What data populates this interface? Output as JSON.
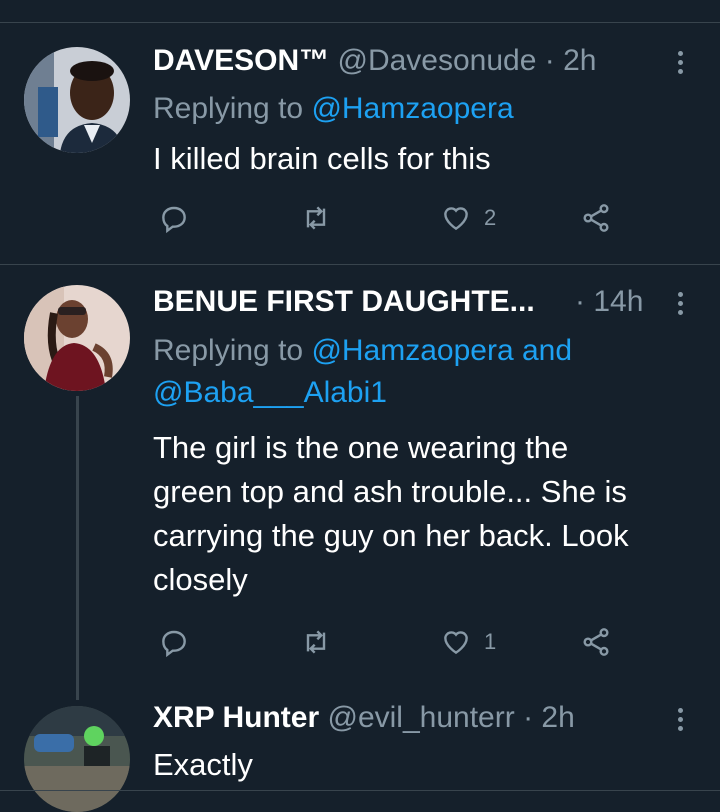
{
  "tweets": [
    {
      "name": "DAVESON™",
      "handle": "@Davesonude",
      "time": "· 2h",
      "reply_prefix": "Replying to",
      "mention1": "@Hamzaopera",
      "text": "I killed brain cells for this",
      "like_count": "2"
    },
    {
      "name": "BENUE FIRST DAUGHTE...",
      "time": "· 14h",
      "reply_prefix": "Replying to",
      "mention1": "@Hamzaopera",
      "and": "and",
      "mention2": "@Baba___Alabi1",
      "text_lines": [
        "The girl is the one wearing the",
        "green top and ash trouble... She is",
        "carrying the guy on her back. Look",
        "closely"
      ],
      "like_count": "1"
    },
    {
      "name": "XRP Hunter",
      "handle": "@evil_hunterr",
      "time": "· 2h",
      "text": "Exactly"
    }
  ],
  "icons": [
    "reply-icon",
    "retweet-icon",
    "like-icon",
    "share-icon",
    "more-icon"
  ],
  "colors": {
    "background": "#15202b",
    "text": "#ffffff",
    "secondary": "#8899a6",
    "link": "#1da1f2",
    "divider": "#38444d"
  }
}
